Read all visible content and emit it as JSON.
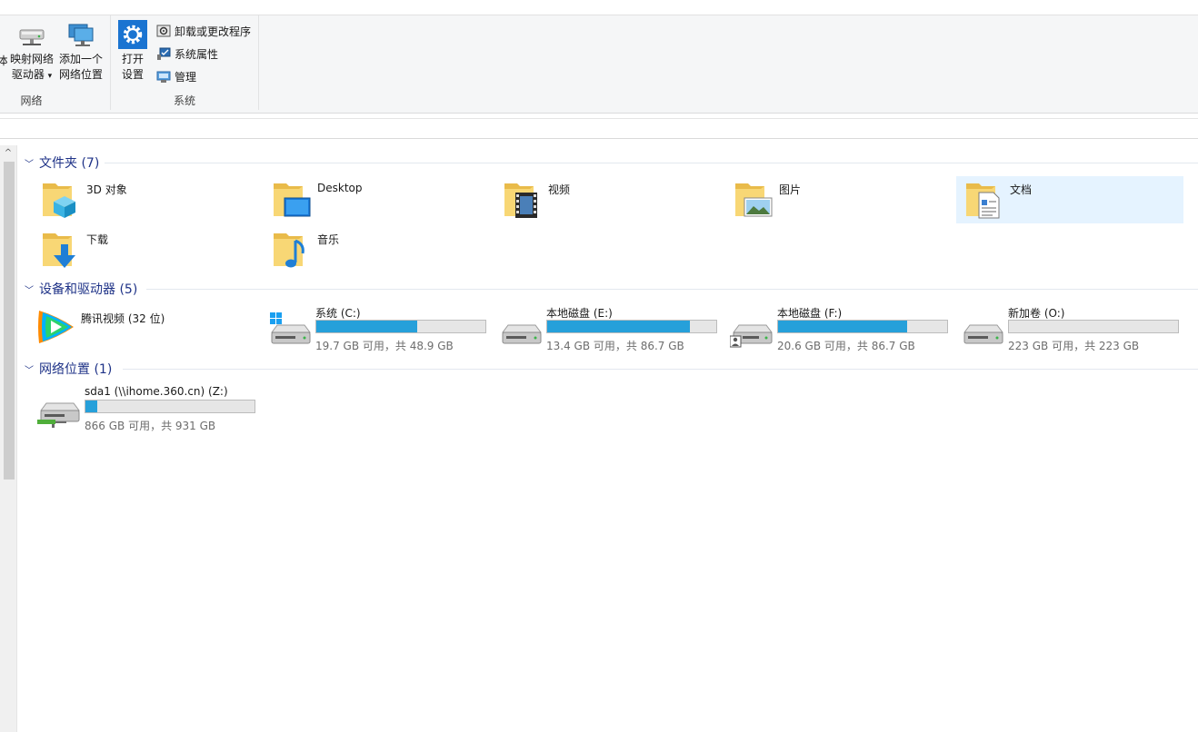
{
  "ribbon": {
    "network_group": {
      "label": "网络",
      "cut_label": "本",
      "map_drive": {
        "line1": "映射网络",
        "line2": "驱动器",
        "dropdown": "▾"
      },
      "add_location": {
        "line1": "添加一个",
        "line2": "网络位置"
      }
    },
    "system_group": {
      "label": "系统",
      "open_settings": {
        "line1": "打开",
        "line2": "设置"
      },
      "uninstall": "卸载或更改程序",
      "properties": "系统属性",
      "manage": "管理"
    }
  },
  "sections": {
    "folders": {
      "title": "文件夹 (7)"
    },
    "drives": {
      "title": "设备和驱动器 (5)"
    },
    "network": {
      "title": "网络位置 (1)"
    }
  },
  "folders": [
    {
      "name": "3D 对象",
      "icon": "3d-objects-folder-icon"
    },
    {
      "name": "Desktop",
      "icon": "desktop-folder-icon"
    },
    {
      "name": "视频",
      "icon": "videos-folder-icon"
    },
    {
      "name": "图片",
      "icon": "pictures-folder-icon"
    },
    {
      "name": "文档",
      "icon": "documents-folder-icon",
      "selected": true
    },
    {
      "name": "下载",
      "icon": "downloads-folder-icon"
    },
    {
      "name": "音乐",
      "icon": "music-folder-icon"
    }
  ],
  "drives": [
    {
      "name": "腾讯视频 (32 位)",
      "icon": "tencent-video-icon"
    },
    {
      "name": "系统 (C:)",
      "free": "19.7 GB 可用，共 48.9 GB",
      "used_fraction": 0.597,
      "icon": "windows-drive-icon"
    },
    {
      "name": "本地磁盘 (E:)",
      "free": "13.4 GB 可用，共 86.7 GB",
      "used_fraction": 0.845,
      "icon": "hard-drive-icon"
    },
    {
      "name": "本地磁盘 (F:)",
      "free": "20.6 GB 可用，共 86.7 GB",
      "used_fraction": 0.762,
      "icon": "hard-drive-user-icon"
    },
    {
      "name": "新加卷 (O:)",
      "free": "223 GB 可用，共 223 GB",
      "used_fraction": 0.0,
      "icon": "hard-drive-icon"
    }
  ],
  "network_locations": [
    {
      "name": "sda1 (\\\\ihome.360.cn) (Z:)",
      "free": "866 GB 可用，共 931 GB",
      "used_fraction": 0.07,
      "icon": "network-drive-icon"
    }
  ],
  "colors": {
    "accent": "#26a0da",
    "section_text": "#1e3287",
    "selection": "#e5f3ff"
  }
}
